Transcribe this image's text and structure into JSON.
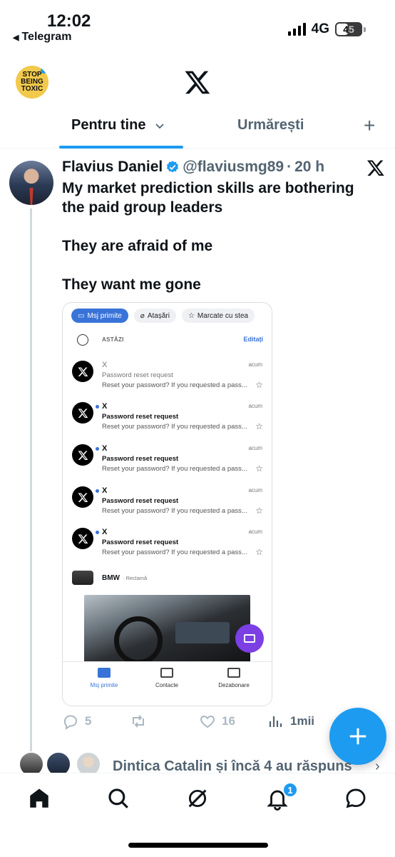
{
  "status_bar": {
    "time": "12:02",
    "back_app": "Telegram",
    "network": "4G",
    "battery": "45"
  },
  "header": {
    "avatar_text_lines": [
      "STOP",
      "BEING",
      "TOXIC"
    ],
    "logo": "x-logo"
  },
  "tabs": [
    {
      "label": "Pentru tine",
      "active": true
    },
    {
      "label": "Urmărești",
      "active": false
    }
  ],
  "post": {
    "name": "Flavius Daniel",
    "handle": "@flaviusmg89",
    "separator": "·",
    "time": "20 h",
    "text": [
      "My market prediction skills are bothering the paid group leaders",
      "They are afraid of me",
      "They want me gone"
    ],
    "counts": {
      "replies": "5",
      "reposts": "",
      "likes": "16",
      "views": "1mii"
    }
  },
  "embedded_screenshot": {
    "chips": [
      "Msj primite",
      "Atașări",
      "Marcate cu stea"
    ],
    "section_label": "ASTĂZI",
    "edit_label": "Editați",
    "emails": [
      {
        "from": "X",
        "subject": "Password reset request",
        "preview": "Reset your password? If you requested a pass...",
        "time": "acum",
        "unread": false
      },
      {
        "from": "X",
        "subject": "Password reset request",
        "preview": "Reset your password? If you requested a pass...",
        "time": "acum",
        "unread": true
      },
      {
        "from": "X",
        "subject": "Password reset request",
        "preview": "Reset your password? If you requested a pass...",
        "time": "acum",
        "unread": true
      },
      {
        "from": "X",
        "subject": "Password reset request",
        "preview": "Reset your password? If you requested a pass...",
        "time": "acum",
        "unread": true
      },
      {
        "from": "X",
        "subject": "Password reset request",
        "preview": "Reset your password? If you requested a pass...",
        "time": "acum",
        "unread": true
      }
    ],
    "ad": {
      "brand": "BMW",
      "tag": "· Reclamă"
    },
    "nav": [
      "Msj primite",
      "Contacte",
      "Dezabonare"
    ]
  },
  "replies_row": {
    "text": "Dintica Catalin și încă 4 au răspuns"
  },
  "bottom_nav": {
    "notification_badge": "1"
  },
  "colors": {
    "accent": "#1d9bf0",
    "mail_accent": "#3a73d8",
    "fab_mini": "#7b3fe4"
  }
}
